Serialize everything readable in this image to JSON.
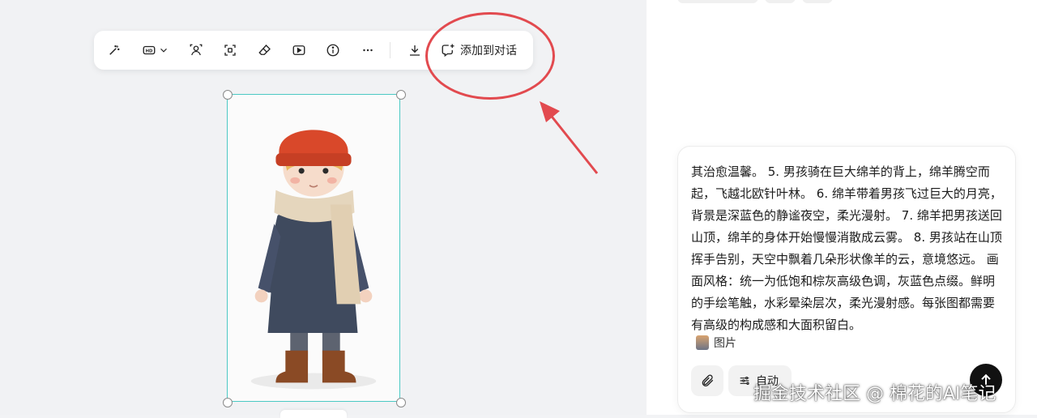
{
  "toolbar": {
    "add_to_chat_label": "添加到对话",
    "icons": [
      "magic-wand-icon",
      "hd-icon",
      "chevron-down-icon",
      "portrait-icon",
      "focus-icon",
      "eraser-icon",
      "play-icon",
      "info-icon",
      "more-icon",
      "download-icon",
      "add-chat-icon"
    ]
  },
  "annotation": {
    "color": "#e24a4f"
  },
  "image": {
    "description_colors": {
      "hat": "#d9482a",
      "coat": "#3f4a5e",
      "scarf": "#e5d6bd",
      "boots": "#8a4a25"
    },
    "frame_color": "#4cc9c4"
  },
  "message": {
    "text": "其治愈温馨。 5. 男孩骑在巨大绵羊的背上，绵羊腾空而起，飞越北欧针叶林。 6. 绵羊带着男孩飞过巨大的月亮，背景是深蓝色的静谧夜空，柔光漫射。 7. 绵羊把男孩送回山顶，绵羊的身体开始慢慢消散成云雾。 8. 男孩站在山顶挥手告别，天空中飘着几朵形状像羊的云，意境悠远。 画面风格：统一为低饱和棕灰高级色调，灰蓝色点缀。鲜明的手绘笔触，水彩晕染层次，柔光漫射感。每张图都需要有高级的构成感和大面积留白。",
    "attachment_label": "图片",
    "auto_label": "自动"
  },
  "watermark": "掘金技术社区 @ 棉花的AI笔记"
}
